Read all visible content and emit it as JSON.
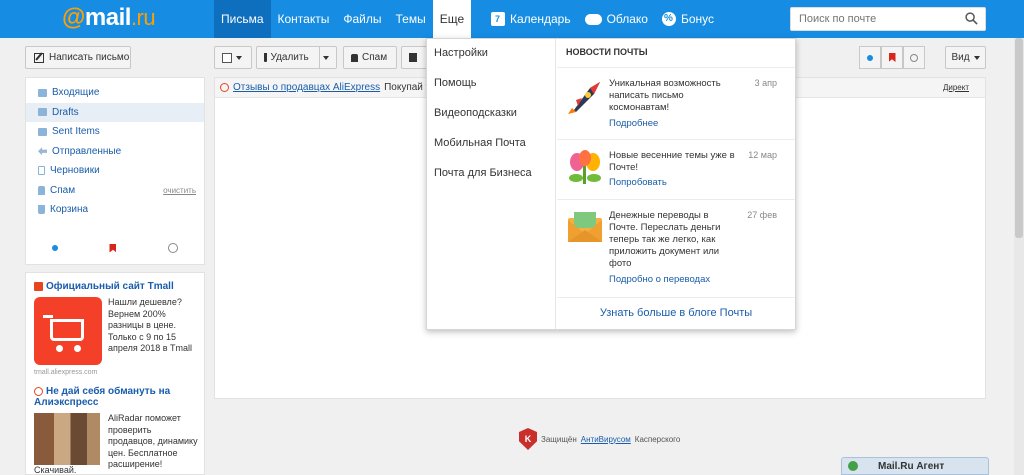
{
  "header": {
    "logo_at": "@",
    "logo_mail": "mail",
    "logo_ru": ".ru",
    "nav": [
      "Письма",
      "Контакты",
      "Файлы",
      "Темы",
      "Еще"
    ],
    "nav_right": [
      "Календарь",
      "Облако",
      "Бонус"
    ],
    "search_placeholder": "Поиск по почте"
  },
  "compose_label": "Написать письмо",
  "folders": [
    {
      "label": "Входящие"
    },
    {
      "label": "Drafts"
    },
    {
      "label": "Sent Items"
    },
    {
      "label": "Отправленные"
    },
    {
      "label": "Черновики"
    },
    {
      "label": "Спам",
      "action": "очистить"
    },
    {
      "label": "Корзина"
    }
  ],
  "toolbar": {
    "delete_label": "Удалить",
    "spam_label": "Спам",
    "view_label": "Вид"
  },
  "promo": {
    "link": "Отзывы о продавцах AliExpress",
    "text": "Покупай у",
    "direct": "Директ"
  },
  "ads": {
    "tmall_title": "Официальный сайт Tmall",
    "tmall_lines": [
      "Нашли дешевле?",
      "Вернем 200%",
      "разницы в цене.",
      "Только с 9 по 15",
      "апреля 2018 в Tmall"
    ],
    "tmall_src": "tmall.aliexpress.com",
    "ali_title_1": "Не дай себя обмануть на",
    "ali_title_2": "Алиэкспресс",
    "ali_lines": [
      "AliRadar поможет",
      "проверить",
      "продавцов, динамику",
      "цен. Бесплатное",
      "расширение!"
    ],
    "ali_last": "Скачивай."
  },
  "dropdown": {
    "items": [
      "Настройки",
      "Помощь",
      "Видеоподсказки",
      "Мобильная Почта",
      "Почта для Бизнеса"
    ],
    "news_header": "НОВОСТИ ПОЧТЫ",
    "news": [
      {
        "lines": [
          "Уникальная возможность",
          "написать письмо",
          "космонавтам!"
        ],
        "date": "3 апр",
        "link": "Подробнее"
      },
      {
        "lines": [
          "Новые весенние темы уже в",
          "Почте!"
        ],
        "date": "12 мар",
        "link": "Попробовать"
      },
      {
        "lines": [
          "Денежные переводы в",
          "Почте. Переслать деньги",
          "теперь так же легко, как",
          "приложить документ или",
          "фото"
        ],
        "date": "27 фев",
        "link": "Подробно о переводах"
      }
    ],
    "blog_link": "Узнать больше в блоге Почты"
  },
  "footer": {
    "av_prefix": "Защищён",
    "av_link": "АнтиВирусом",
    "av_suffix": "Касперского",
    "k_letter": "K"
  },
  "agent_label": "Mail.Ru Агент",
  "colors": {
    "header_bg": "#168de2",
    "logo_orange": "#ff9e00",
    "link_blue": "#1a5dab",
    "flag_red": "#d9261c"
  }
}
